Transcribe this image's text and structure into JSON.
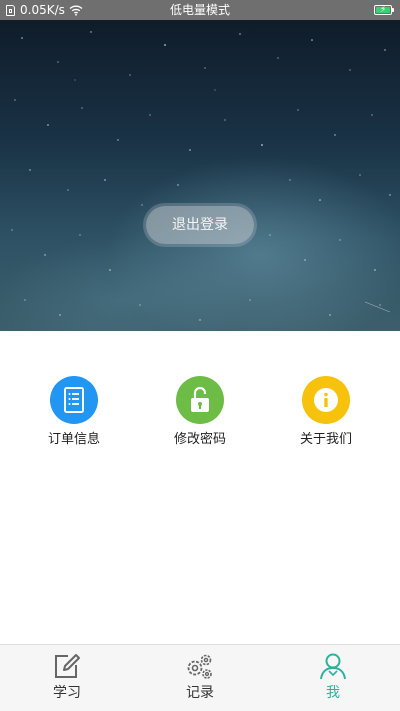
{
  "status_bar": {
    "net_speed": "0.05K/s",
    "mode_text": "低电量模式",
    "battery_color": "#3cd070"
  },
  "hero": {
    "logout_label": "退出登录"
  },
  "menu": [
    {
      "label": "订单信息",
      "icon": "document-list-icon",
      "color": "#2196f3"
    },
    {
      "label": "修改密码",
      "icon": "unlock-icon",
      "color": "#6cbc45"
    },
    {
      "label": "关于我们",
      "icon": "info-icon",
      "color": "#f7c20c"
    }
  ],
  "tabs": [
    {
      "label": "学习",
      "icon": "pencil-square-icon",
      "active": false
    },
    {
      "label": "记录",
      "icon": "gears-icon",
      "active": false
    },
    {
      "label": "我",
      "icon": "user-icon",
      "active": true
    }
  ],
  "colors": {
    "accent": "#2bb39a",
    "status_bar": "#6f6f6f"
  }
}
